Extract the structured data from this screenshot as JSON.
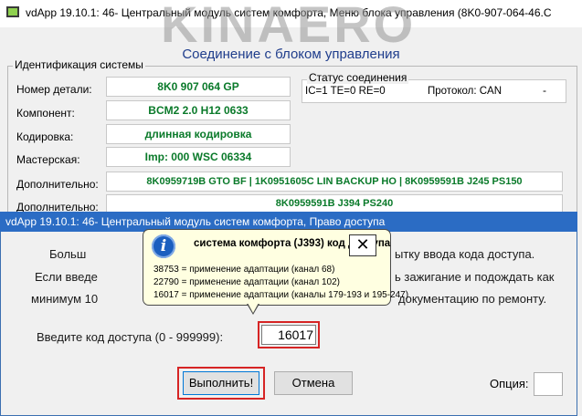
{
  "main_window": {
    "title": "vdApp 19.10.1: 46- Центральный модуль систем комфорта,  Меню блока управления (8K0-907-064-46.C",
    "watermark": "KINAERO",
    "connection_header": "Соединение с блоком управления"
  },
  "identification": {
    "group_title": "Идентификация системы",
    "part_number": {
      "label": "Номер детали:",
      "value": "8K0 907 064 GP"
    },
    "component": {
      "label": "Компонент:",
      "value": "BCM2 2.0      H12 0633"
    },
    "coding": {
      "label": "Кодировка:",
      "value": "длинная кодировка"
    },
    "workshop": {
      "label": "Мастерская:",
      "value": "Imp: 000     WSC 06334"
    },
    "additional1": {
      "label": "Дополнительно:",
      "value": "8K0959719B GTO BF  |  1K0951605C LIN BACKUP HO  |  8K0959591B J245 PS150"
    },
    "additional2": {
      "label": "Дополнительно:",
      "value": "8K0959591B J394 PS240"
    }
  },
  "connection_status": {
    "title": "Статус соединения",
    "values": "IC=1  TE=0   RE=0",
    "protocol": "Протокол: CAN",
    "indicator": "-"
  },
  "access_dialog": {
    "title": "vdApp 19.10.1: 46- Центральный модуль систем комфорта,  Право доступа",
    "line1_left": "Больш",
    "line1_right": "ытку ввода кода доступа.",
    "line2_left": "Если введе",
    "line2_right": "ь зажигание и подождать как",
    "line3_left": "минимум 10",
    "line3_right": "документацию по ремонту.",
    "code_label": "Введите код доступа (0 - 999999):",
    "code_value": "16017",
    "execute_label": "Выполнить!",
    "cancel_label": "Отмена",
    "option_label": "Опция:"
  },
  "tooltip": {
    "title": "система комфорта (J393) код доступа",
    "close_symbol": "✕",
    "lines": [
      "38753 = применение адаптации (канал 68)",
      "22790 = применение адаптации (канал 102)",
      "16017 = применение адаптации (каналы 179-193 и 195-247)"
    ]
  },
  "icons": {
    "app": "app-icon",
    "info": "info-icon",
    "close": "close-icon"
  },
  "colors": {
    "field_text": "#0a7a2a",
    "dialog_titlebar": "#2b6cc4",
    "highlight": "#d62424",
    "header_text": "#1f3d8c",
    "tooltip_bg": "#ffffe1"
  }
}
